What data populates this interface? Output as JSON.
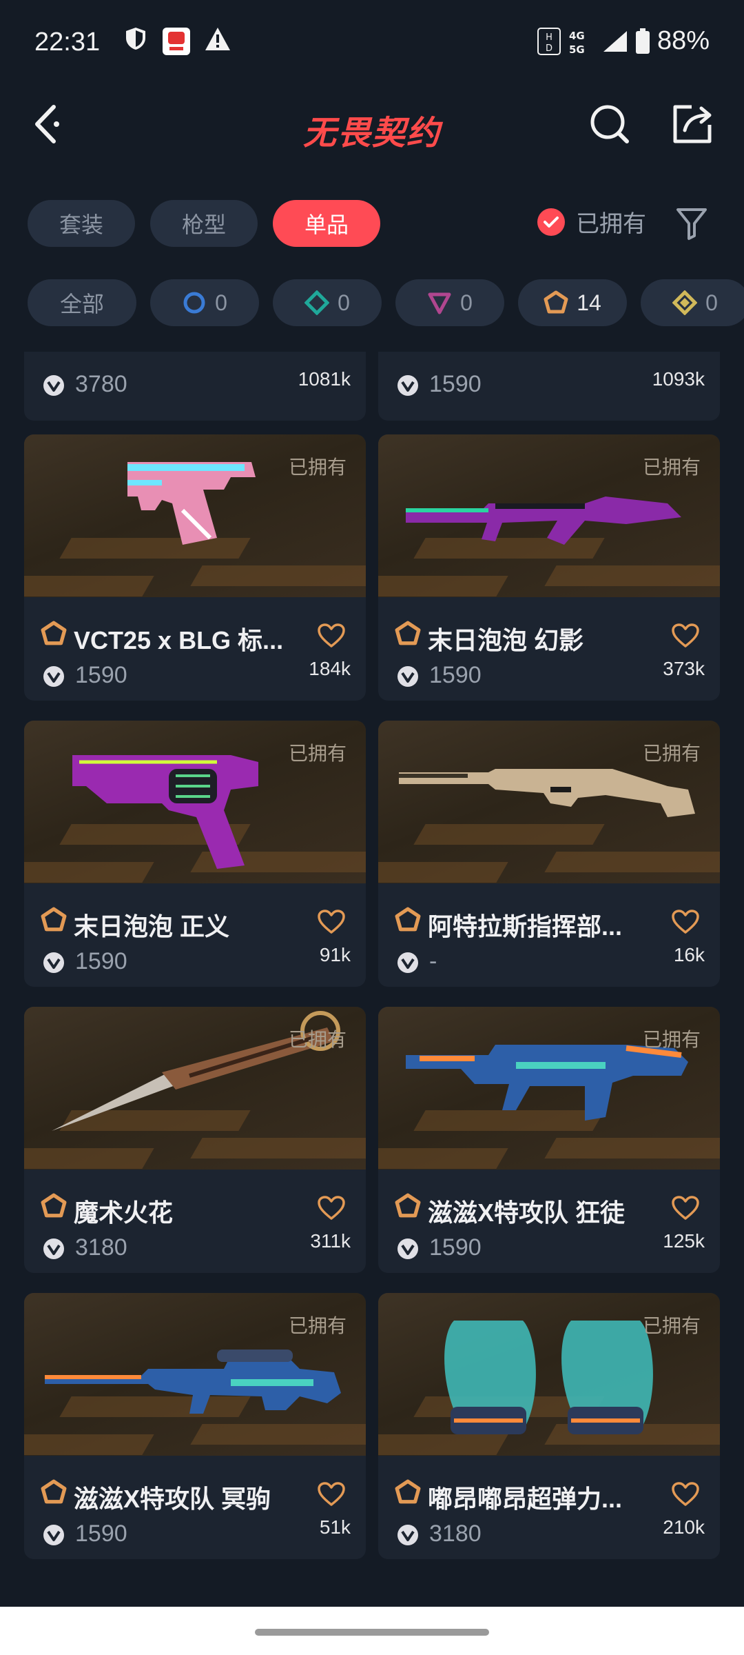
{
  "status_bar": {
    "time": "22:31",
    "network": "4G 5G",
    "battery": "88%"
  },
  "header": {
    "title": "无畏契约"
  },
  "tabs": [
    {
      "label": "套装",
      "active": false
    },
    {
      "label": "枪型",
      "active": false
    },
    {
      "label": "单品",
      "active": true
    }
  ],
  "owned_filter": {
    "label": "已拥有",
    "checked": true
  },
  "rarity_filter": {
    "all_label": "全部",
    "tiers": [
      {
        "name": "select-tier",
        "count": "0",
        "color": "#3a7bd5"
      },
      {
        "name": "deluxe-tier",
        "count": "0",
        "color": "#1fa89a"
      },
      {
        "name": "premium-tier",
        "count": "0",
        "color": "#b0468f"
      },
      {
        "name": "exclusive-tier",
        "count": "14",
        "color": "#e39a55"
      },
      {
        "name": "ultra-tier",
        "count": "0",
        "color": "#d1b95a"
      }
    ]
  },
  "partial_cards": [
    {
      "price": "3780",
      "likes": "1081k"
    },
    {
      "price": "1590",
      "likes": "1093k"
    }
  ],
  "cards": [
    {
      "name": "VCT25 x BLG 标...",
      "price": "1590",
      "likes": "184k",
      "owned": "已拥有",
      "weapon": "pistol-pink"
    },
    {
      "name": "末日泡泡 幻影",
      "price": "1590",
      "likes": "373k",
      "owned": "已拥有",
      "weapon": "rifle-purple"
    },
    {
      "name": "末日泡泡 正义",
      "price": "1590",
      "likes": "91k",
      "owned": "已拥有",
      "weapon": "revolver-purple"
    },
    {
      "name": "阿特拉斯指挥部...",
      "price": "-",
      "likes": "16k",
      "owned": "已拥有",
      "weapon": "sniper-tan"
    },
    {
      "name": "魔术火花",
      "price": "3180",
      "likes": "311k",
      "owned": "已拥有",
      "weapon": "knife"
    },
    {
      "name": "滋滋X特攻队 狂徒",
      "price": "1590",
      "likes": "125k",
      "owned": "已拥有",
      "weapon": "rifle-blue"
    },
    {
      "name": "滋滋X特攻队 冥驹",
      "price": "1590",
      "likes": "51k",
      "owned": "已拥有",
      "weapon": "sniper-blue"
    },
    {
      "name": "嘟昂嘟昂超弹力...",
      "price": "3180",
      "likes": "210k",
      "owned": "已拥有",
      "weapon": "gloves"
    }
  ],
  "colors": {
    "accent": "#ff4b55",
    "background": "#141b25",
    "card": "#1c2430",
    "tier_exclusive": "#e39a55"
  }
}
